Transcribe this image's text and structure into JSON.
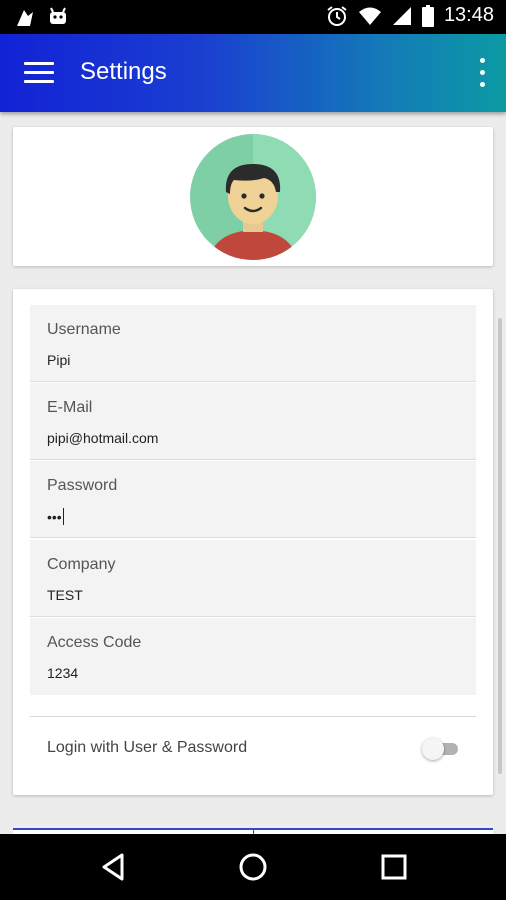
{
  "status_bar": {
    "time": "13:48",
    "left_icons": [
      "android-icon",
      "android-robot-icon"
    ],
    "right_icons": [
      "alarm-icon",
      "wifi-icon",
      "signal-icon",
      "battery-icon"
    ]
  },
  "app_bar": {
    "title": "Settings",
    "gradient_colors": [
      "#1222d6",
      "#0b9aa3"
    ],
    "menu_icon": "hamburger-menu-icon",
    "overflow_icon": "more-vert-icon"
  },
  "profile": {
    "avatar_icon": "user-avatar-icon"
  },
  "form": {
    "fields": [
      {
        "label": "Username",
        "value": "Pipi"
      },
      {
        "label": "E-Mail",
        "value": "pipi@hotmail.com"
      },
      {
        "label": "Password",
        "value": "•••"
      },
      {
        "label": "Company",
        "value": "TEST"
      },
      {
        "label": "Access Code",
        "value": "1234"
      }
    ],
    "toggle": {
      "label": "Login with User & Password",
      "checked": false
    }
  },
  "nav_bar": {
    "icons": [
      "back-icon",
      "home-icon",
      "recents-icon"
    ]
  }
}
